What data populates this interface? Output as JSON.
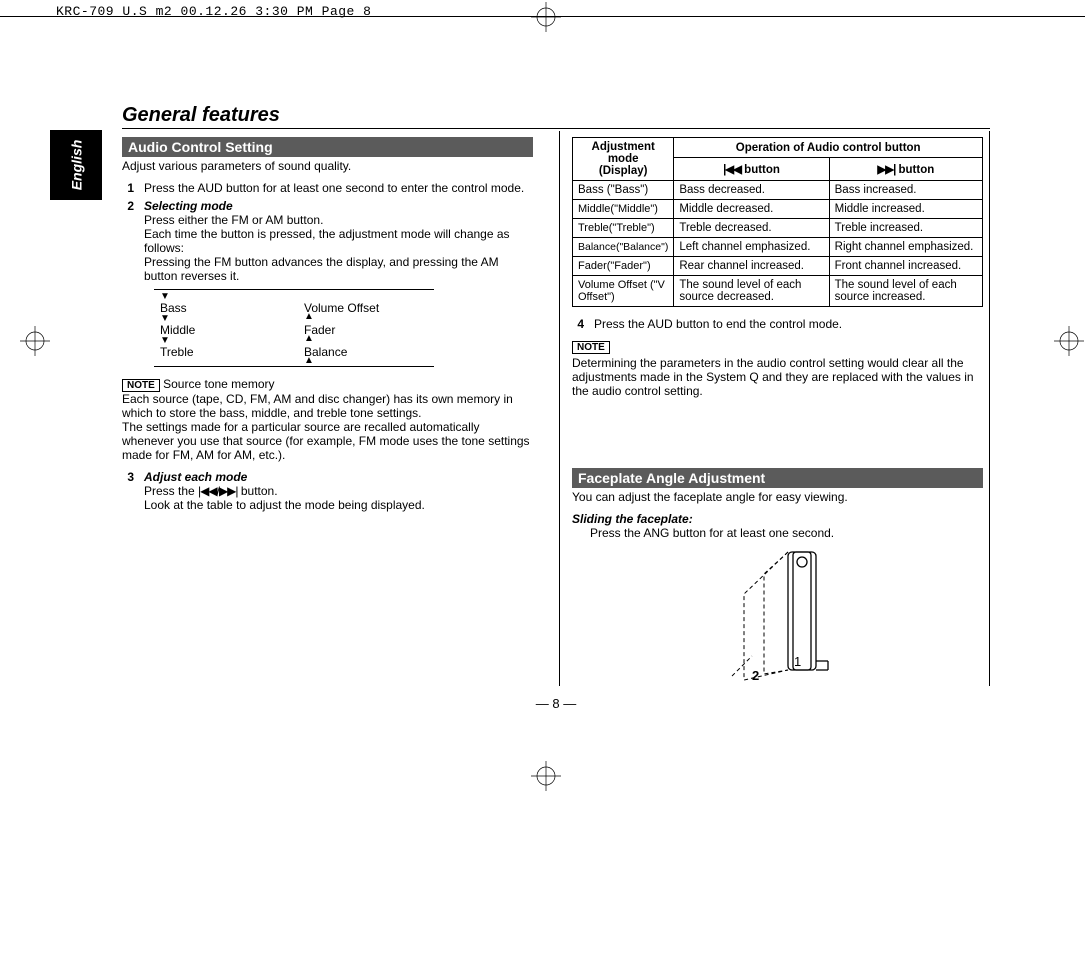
{
  "crop_header": "KRC-709_U.S_m2  00.12.26 3:30 PM  Page 8",
  "lang_tab": "English",
  "section_title": "General features",
  "audio": {
    "bar": "Audio Control Setting",
    "lead": "Adjust various parameters of sound quality.",
    "step1_num": "1",
    "step1_body": "Press the AUD button for at least one second to enter the control mode.",
    "step2_num": "2",
    "step2_title": "Selecting mode",
    "step2_l1": "Press either the FM or AM button.",
    "step2_l2": "Each time the button is pressed, the adjustment mode will change as follows:",
    "step2_l3": "Pressing the FM button advances the display, and pressing the AM button reverses it.",
    "flow": {
      "l1": "Bass",
      "l2": "Middle",
      "l3": "Treble",
      "r1": "Volume Offset",
      "r2": "Fader",
      "r3": "Balance"
    },
    "note_label": "NOTE",
    "note_title": "Source tone memory",
    "note_p1": "Each source (tape, CD, FM, AM and disc changer) has its own memory in which to store the bass, middle, and treble tone settings.",
    "note_p2": "The settings made for a particular source are recalled automatically whenever you use that source (for example, FM mode uses the tone settings made for FM, AM for AM, etc.).",
    "step3_num": "3",
    "step3_title": "Adjust each mode",
    "step3_l1a": "Press the ",
    "step3_l1b": " button.",
    "step3_l2": "Look at the table to adjust the mode being displayed.",
    "step4_num": "4",
    "step4_body": "Press the AUD button to end the control mode.",
    "note2_body": "Determining the parameters in the audio control setting would clear all the adjustments made in the System Q and they are replaced with the values in the audio control setting."
  },
  "table": {
    "hdr_mode_l1": "Adjustment",
    "hdr_mode_l2": "mode",
    "hdr_mode_l3": "(Display)",
    "hdr_op": "Operation of Audio control button",
    "hdr_prev": " button",
    "hdr_next": " button",
    "rows": [
      {
        "mode": "Bass (\"Bass\")",
        "prev": "Bass decreased.",
        "next": "Bass increased."
      },
      {
        "mode": "Middle(\"Middle\")",
        "prev": "Middle decreased.",
        "next": "Middle increased."
      },
      {
        "mode": "Treble(\"Treble\")",
        "prev": "Treble decreased.",
        "next": "Treble increased."
      },
      {
        "mode": "Balance(\"Balance\")",
        "prev": "Left channel emphasized.",
        "next": "Right channel emphasized."
      },
      {
        "mode": "Fader(\"Fader\")",
        "prev": "Rear channel increased.",
        "next": "Front channel increased."
      },
      {
        "mode": "Volume Offset (\"V Offset\")",
        "prev": "The sound level of each source decreased.",
        "next": "The sound level of each source increased."
      }
    ]
  },
  "faceplate": {
    "bar": "Faceplate Angle Adjustment",
    "lead": "You can adjust the faceplate angle for easy viewing.",
    "sub_title": "Sliding the faceplate:",
    "sub_body": "Press the ANG button for at least one second.",
    "fig_1": "1",
    "fig_2": "2"
  },
  "icons": {
    "prev": "|◀◀",
    "next": "▶▶|",
    "prevnext": "|◀◀/▶▶|"
  },
  "page_number": "— 8 —"
}
